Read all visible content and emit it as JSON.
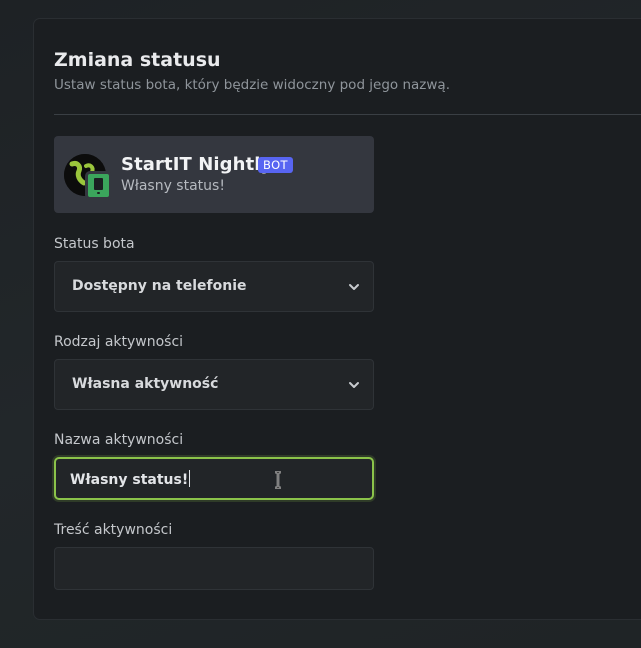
{
  "header": {
    "title": "Zmiana statusu",
    "subtitle": "Ustaw status bota, który będzie widoczny pod jego nazwą."
  },
  "preview": {
    "bot_name": "StartIT Nightly",
    "bot_tag": "BOT",
    "status_text": "Własny status!",
    "status_icon": "mobile-phone-icon",
    "status_color": "#3ba55c",
    "tag_color": "#5865f2"
  },
  "form": {
    "status_label": "Status bota",
    "status_value": "Dostępny na telefonie",
    "activity_type_label": "Rodzaj aktywności",
    "activity_type_value": "Własna aktywność",
    "activity_name_label": "Nazwa aktywności",
    "activity_name_value": "Własny status!",
    "activity_content_label": "Treść aktywności",
    "activity_content_value": ""
  },
  "colors": {
    "focus_border": "#8bc34a",
    "panel_bg": "#1b1e21",
    "input_bg": "#222528"
  }
}
